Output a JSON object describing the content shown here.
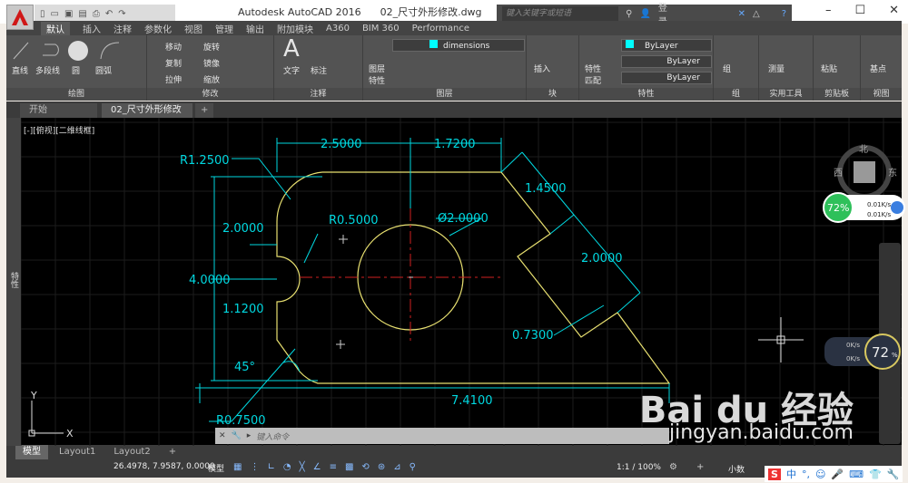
{
  "title": {
    "app": "Autodesk AutoCAD 2016",
    "file": "02_尺寸外形修改.dwg"
  },
  "search": {
    "placeholder": "键入关键字或短语",
    "login": "登录"
  },
  "ribbon_tabs": [
    "默认",
    "插入",
    "注释",
    "参数化",
    "视图",
    "管理",
    "输出",
    "附加模块",
    "A360",
    "BIM 360",
    "Performance"
  ],
  "active_tab": "默认",
  "panels": {
    "draw": {
      "label": "绘图",
      "tools": [
        "直线",
        "多段线",
        "圆",
        "圆弧"
      ]
    },
    "modify": {
      "label": "修改",
      "tools": [
        "移动",
        "旋转",
        "复制",
        "镜像",
        "拉伸",
        "缩放"
      ]
    },
    "annotation": {
      "label": "注释",
      "tools": [
        "文字",
        "标注"
      ]
    },
    "layers": {
      "label": "图层",
      "tool": "图层特性",
      "current_layer": "dimensions"
    },
    "block": {
      "label": "块",
      "tool": "插入"
    },
    "properties": {
      "label": "特性",
      "tool": "特性匹配",
      "color": "ByLayer",
      "linetype": "ByLayer",
      "lineweight": "ByLayer"
    },
    "group": {
      "label": "组",
      "tool": "组"
    },
    "utilities": {
      "label": "实用工具",
      "tool": "测量"
    },
    "clipboard": {
      "label": "剪贴板",
      "tool": "粘贴"
    },
    "view": {
      "label": "视图",
      "tool": "基点"
    }
  },
  "doc_tabs": [
    "开始",
    "02_尺寸外形修改"
  ],
  "viewport_label": "[-][俯视][二维线框]",
  "side_panel": "特性",
  "viewcube": {
    "n": "北",
    "w": "西",
    "e": "东"
  },
  "dimensions": {
    "d1": "2.5000",
    "d2": "1.7200",
    "d3": "1.4500",
    "d4": "2.0000",
    "d5": "0.7300",
    "d6": "7.4100",
    "r1": "R1.2500",
    "r2": "R0.5000",
    "r3": "R0.7500",
    "dia": "Ø2.0000",
    "v1": "2.0000",
    "v2": "4.0000",
    "v3": "1.1200",
    "ang": "45°"
  },
  "ucs": {
    "x": "X",
    "y": "Y"
  },
  "net_widget": {
    "percent": "72%",
    "up": "0.01K/s",
    "down": "0.01K/s"
  },
  "net_widget2": {
    "percent": "72",
    "unit": "%",
    "up": "0K/s",
    "down": "0K/s"
  },
  "command": {
    "placeholder": "键入命令"
  },
  "layout_tabs": [
    "模型",
    "Layout1",
    "Layout2"
  ],
  "status": {
    "coords": "26.4978, 7.9587, 0.0000",
    "mode": "模型",
    "scale": "1:1 / 100%",
    "units": "小数"
  },
  "watermark": {
    "brand": "Bai du 经验",
    "url": "jingyan.baidu.com"
  },
  "ime": {
    "lang": "中"
  },
  "colors": {
    "geometry": "#e8e070",
    "dimension": "#00d8e0",
    "centerline": "#d02020",
    "background": "#000000"
  }
}
